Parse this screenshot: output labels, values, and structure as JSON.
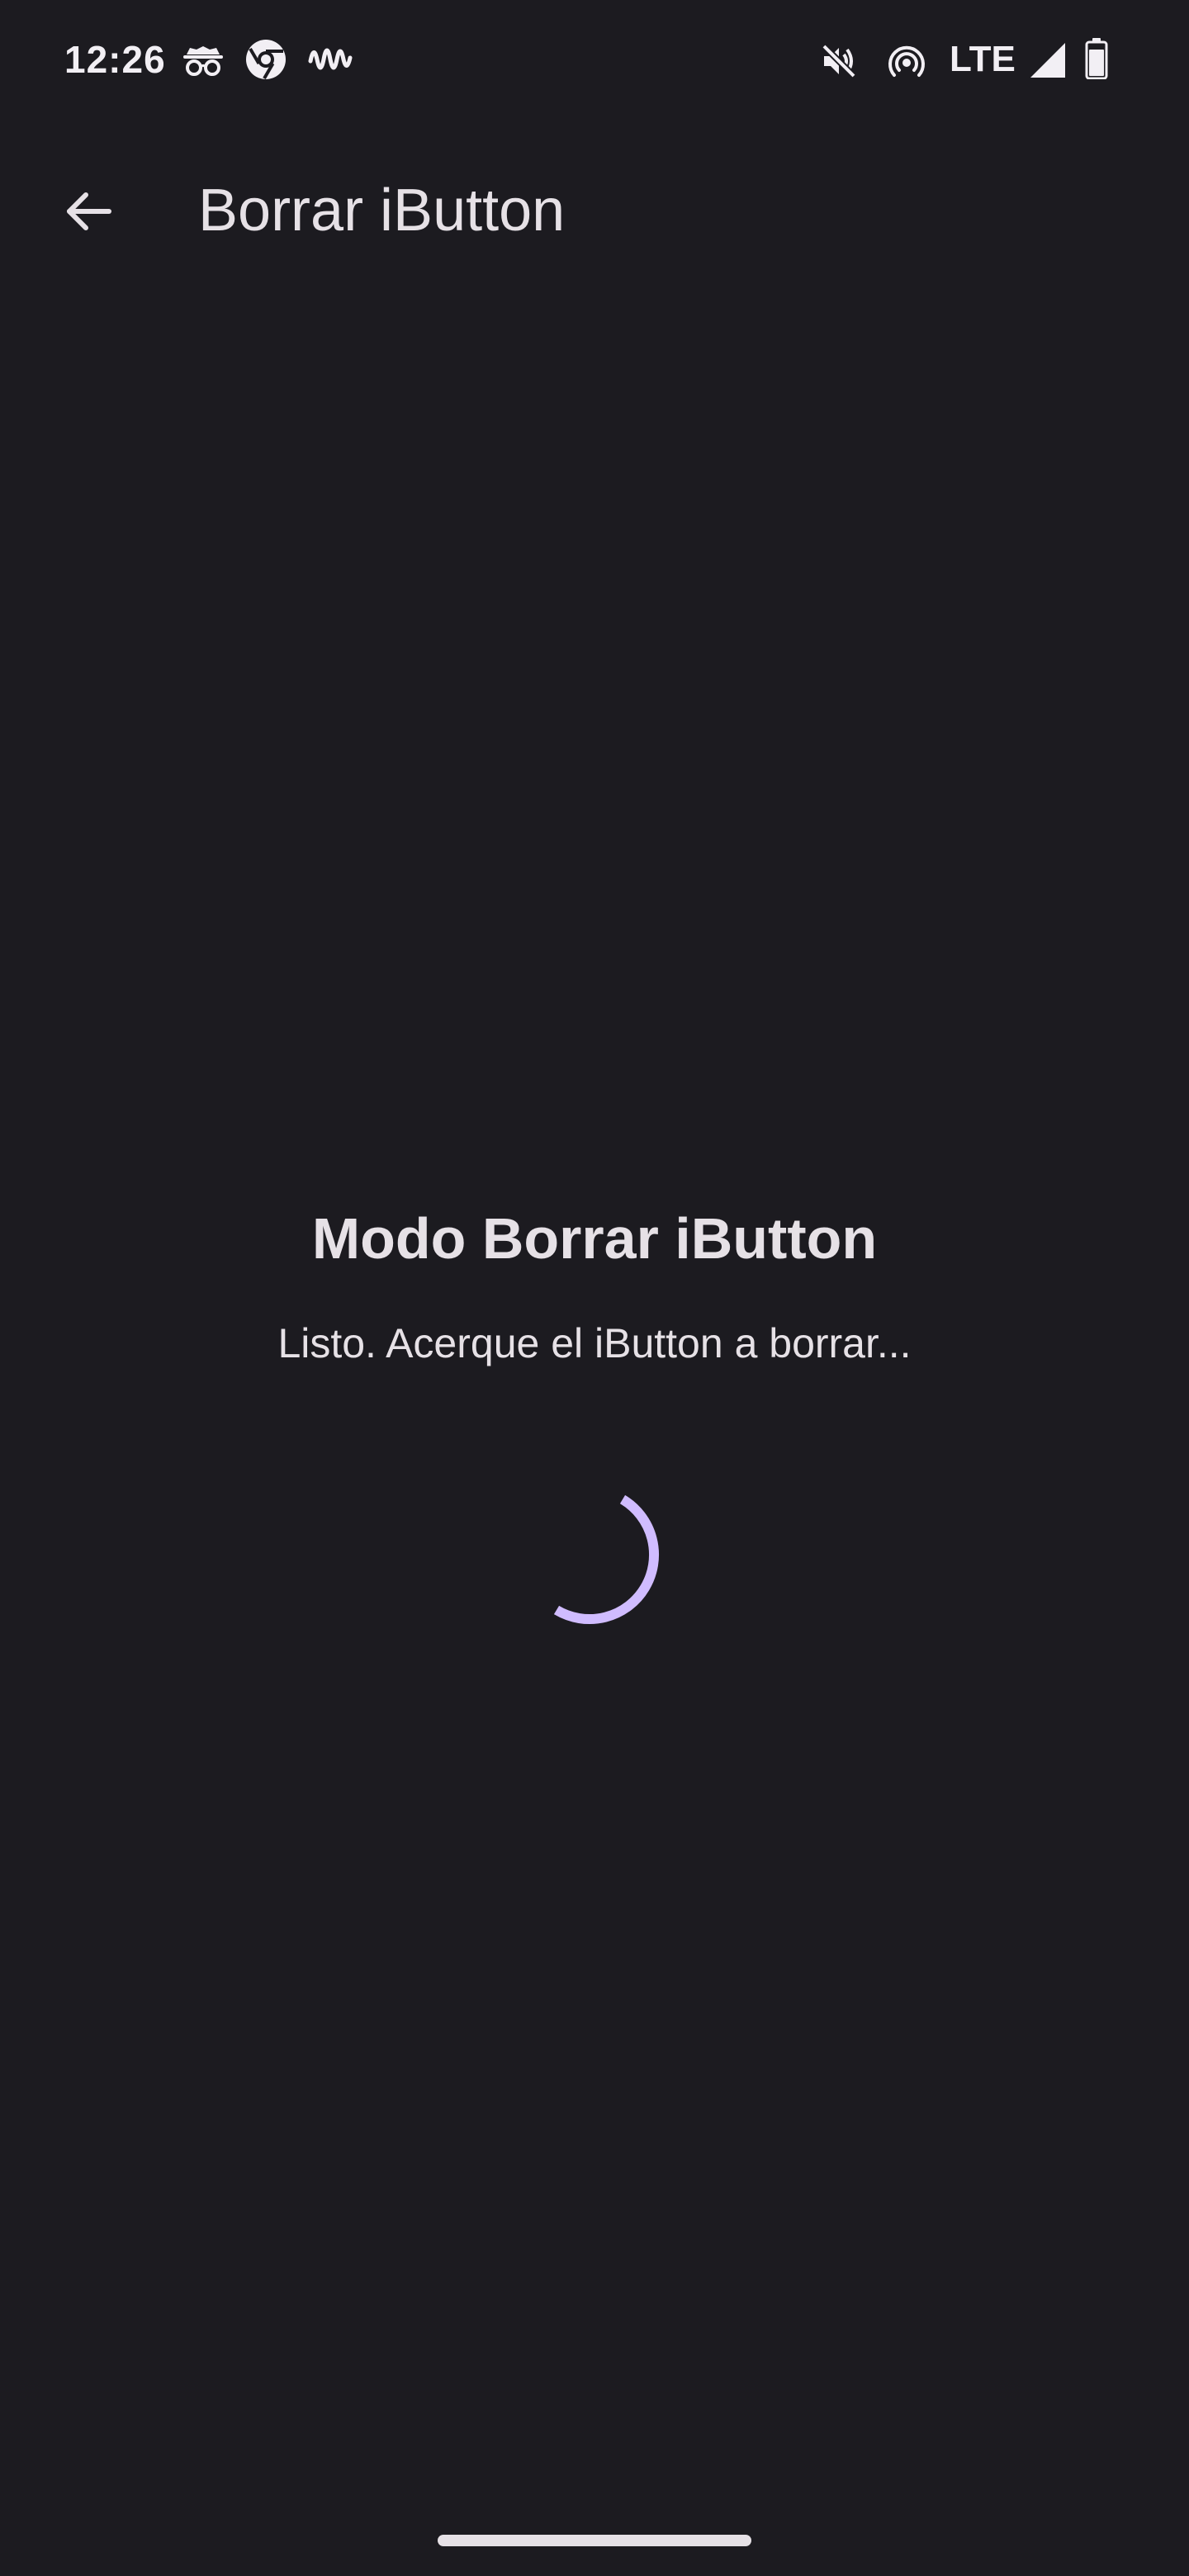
{
  "status_bar": {
    "time": "12:26",
    "network": "LTE",
    "icons": [
      "incognito-icon",
      "chrome-icon",
      "waveform-icon",
      "mute-icon",
      "hotspot-icon",
      "signal-icon",
      "battery-icon"
    ]
  },
  "app_bar": {
    "back_icon": "arrow-back-icon",
    "title": "Borrar iButton"
  },
  "content": {
    "title": "Modo Borrar iButton",
    "subtitle": "Listo. Acerque el iButton a borrar...",
    "spinner_color": "#d0bcff"
  },
  "colors": {
    "background": "#1c1b20",
    "text": "#e6e1e6",
    "accent": "#d0bcff"
  }
}
